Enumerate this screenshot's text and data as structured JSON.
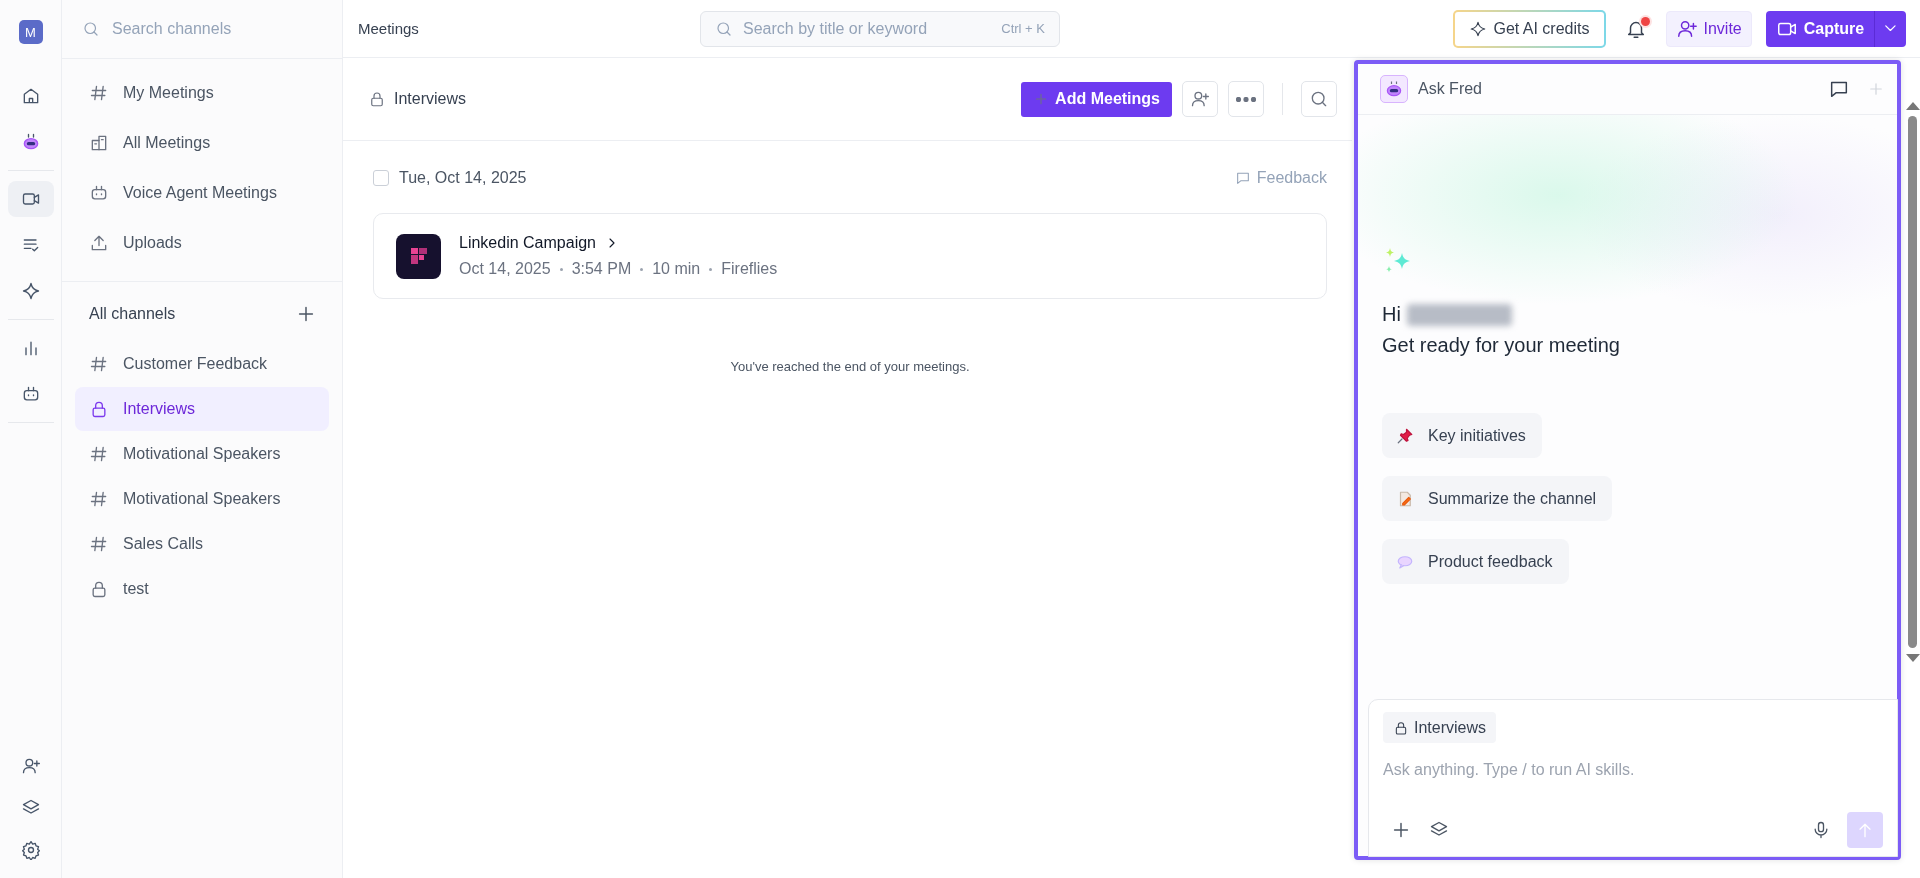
{
  "user_avatar": {
    "initial": "M"
  },
  "rail_groups": [
    [
      {
        "kind": "home",
        "selected": false
      },
      {
        "kind": "bot",
        "selected": false
      }
    ],
    [
      {
        "kind": "video",
        "selected": true
      },
      {
        "kind": "tasks",
        "selected": false
      },
      {
        "kind": "sparkle",
        "selected": false
      }
    ],
    [
      {
        "kind": "chart",
        "selected": false
      },
      {
        "kind": "robot",
        "selected": false
      }
    ]
  ],
  "rail_bottom": [
    {
      "kind": "add-user"
    },
    {
      "kind": "layers"
    },
    {
      "kind": "settings"
    }
  ],
  "sidebar": {
    "search_placeholder": "Search channels",
    "nav": [
      {
        "kind": "hash",
        "label": "My Meetings"
      },
      {
        "kind": "building",
        "label": "All Meetings"
      },
      {
        "kind": "robot",
        "label": "Voice Agent Meetings"
      },
      {
        "kind": "upload",
        "label": "Uploads"
      }
    ],
    "channels_heading": "All channels",
    "channels": [
      {
        "kind": "hash",
        "label": "Customer Feedback",
        "selected": false
      },
      {
        "kind": "lock",
        "label": "Interviews",
        "selected": true
      },
      {
        "kind": "hash",
        "label": "Motivational Speakers",
        "selected": false
      },
      {
        "kind": "hash",
        "label": "Motivational Speakers",
        "selected": false
      },
      {
        "kind": "hash",
        "label": "Sales Calls",
        "selected": false
      },
      {
        "kind": "lock",
        "label": "test",
        "selected": false
      }
    ]
  },
  "topbar": {
    "title": "Meetings",
    "search_placeholder": "Search by title or keyword",
    "shortcut": "Ctrl + K",
    "ai_credits": "Get AI credits",
    "notifications_unread": true,
    "invite": "Invite",
    "capture": "Capture"
  },
  "channel": {
    "title": "Interviews",
    "add_button": "Add Meetings",
    "date": "Tue, Oct 14, 2025",
    "date_checked": false,
    "feedback": "Feedback",
    "meetings": [
      {
        "title": "Linkedin Campaign",
        "meta": [
          "Oct 14, 2025",
          "3:54 PM",
          "10 min",
          "Fireflies"
        ]
      }
    ],
    "end_note": "You've reached the end of your meetings."
  },
  "assistant": {
    "title": "Ask Fred",
    "greeting": "Hi",
    "subtitle": "Get ready for your meeting",
    "suggestions": [
      {
        "kind": "pin",
        "label": "Key initiatives"
      },
      {
        "kind": "memo",
        "label": "Summarize the channel"
      },
      {
        "kind": "speech",
        "label": "Product feedback"
      }
    ],
    "context_chip": "Interviews",
    "input_placeholder": "Ask anything. Type / to run AI skills."
  }
}
